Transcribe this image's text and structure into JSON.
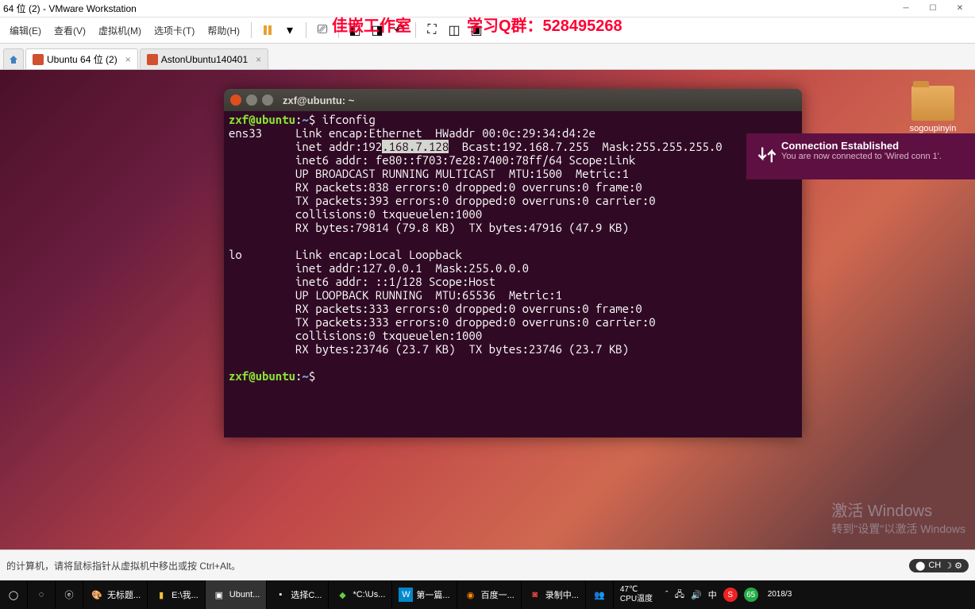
{
  "app": {
    "title": "64 位 (2) - VMware Workstation"
  },
  "menu": {
    "edit": "编辑(E)",
    "view": "查看(V)",
    "vm": "虚拟机(M)",
    "tabs": "选项卡(T)",
    "help": "帮助(H)"
  },
  "overlay": {
    "line1": "佳嵌工作室",
    "line2": "学习Q群：528495268"
  },
  "tabs": {
    "active": "Ubuntu 64 位 (2)",
    "inactive": "AstonUbuntu140401"
  },
  "desktop": {
    "icon1_label": "sogoupinyin"
  },
  "terminal": {
    "title": "zxf@ubuntu: ~",
    "prompt_user": "zxf@ubuntu",
    "prompt_sep": ":",
    "prompt_path": "~",
    "prompt_sym": "$",
    "cmd1": "ifconfig",
    "ens_iface": "ens33",
    "ens_l1a": "Link encap:Ethernet  HWaddr 00:0c:29:34:d4:2e",
    "ens_l2a": "inet addr:192",
    "ens_l2_hl": ".168.7.128",
    "ens_l2b": "  Bcast:192.168.7.255  Mask:255.255.255.0",
    "ens_l3": "inet6 addr: fe80::f703:7e28:7400:78ff/64 Scope:Link",
    "ens_l4": "UP BROADCAST RUNNING MULTICAST  MTU:1500  Metric:1",
    "ens_l5": "RX packets:838 errors:0 dropped:0 overruns:0 frame:0",
    "ens_l6": "TX packets:393 errors:0 dropped:0 overruns:0 carrier:0",
    "ens_l7": "collisions:0 txqueuelen:1000",
    "ens_l8": "RX bytes:79814 (79.8 KB)  TX bytes:47916 (47.9 KB)",
    "lo_iface": "lo",
    "lo_l1": "Link encap:Local Loopback",
    "lo_l2": "inet addr:127.0.0.1  Mask:255.0.0.0",
    "lo_l3": "inet6 addr: ::1/128 Scope:Host",
    "lo_l4": "UP LOOPBACK RUNNING  MTU:65536  Metric:1",
    "lo_l5": "RX packets:333 errors:0 dropped:0 overruns:0 frame:0",
    "lo_l6": "TX packets:333 errors:0 dropped:0 overruns:0 carrier:0",
    "lo_l7": "collisions:0 txqueuelen:1000",
    "lo_l8": "RX bytes:23746 (23.7 KB)  TX bytes:23746 (23.7 KB)"
  },
  "notif": {
    "title": "Connection Established",
    "body": "You are now connected to 'Wired conn 1'."
  },
  "watermark": {
    "line1": "激活 Windows",
    "line2": "转到\"设置\"以激活 Windows"
  },
  "status": {
    "hint": "的计算机，请将鼠标指针从虚拟机中移出或按 Ctrl+Alt。",
    "ime": "CH"
  },
  "taskbar": {
    "items": [
      {
        "label": "无标题..."
      },
      {
        "label": "E:\\我..."
      },
      {
        "label": "Ubunt..."
      },
      {
        "label": "选择C..."
      },
      {
        "label": "*C:\\Us..."
      },
      {
        "label": "第一篇..."
      },
      {
        "label": "百度一..."
      },
      {
        "label": "录制中..."
      }
    ],
    "temp": "47℃",
    "cpu": "CPU温度",
    "lang": "中",
    "badge": "65",
    "date": "2018/3"
  }
}
